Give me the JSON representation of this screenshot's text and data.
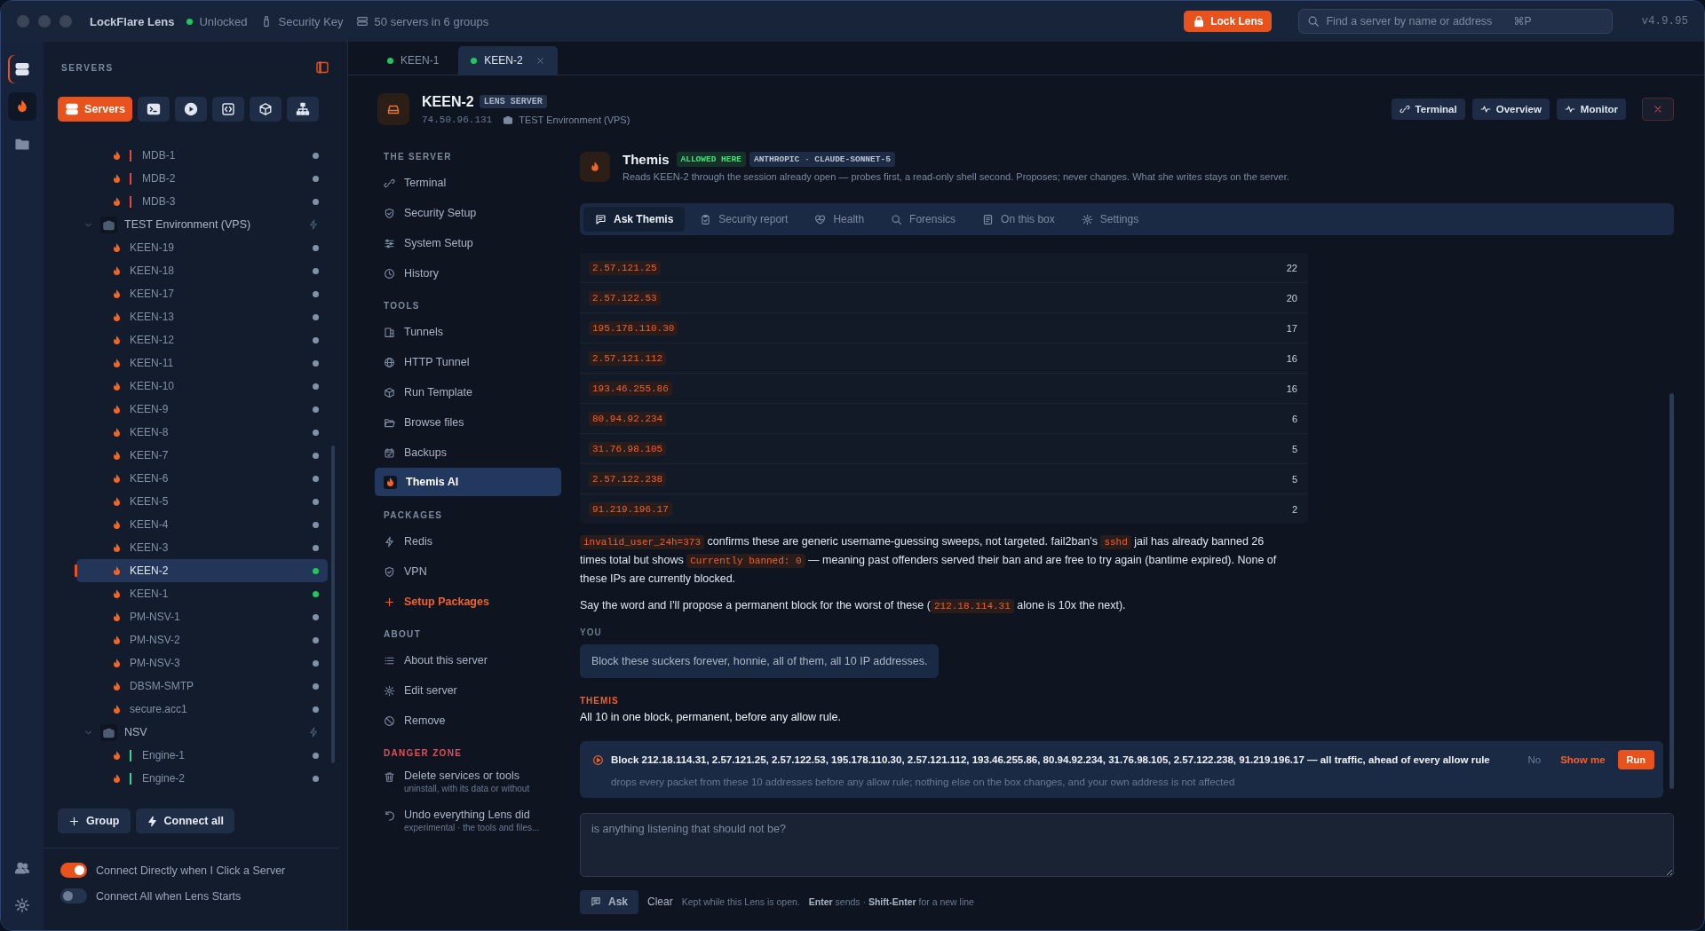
{
  "window": {
    "app_name": "LockFlare Lens",
    "lock_status": "Unlocked",
    "unlocked": true,
    "key_label": "Security Key",
    "server_count": "50 servers in 6 groups",
    "lock_button": "Lock Lens",
    "search": {
      "placeholder": "Find a server by name or address",
      "shortcut": "⌘P"
    },
    "version": "v4.9.95"
  },
  "sidebar": {
    "title": "SERVERS",
    "toolbar": [
      {
        "label": "Servers",
        "selected": true
      },
      {
        "selected": false
      },
      {
        "selected": false
      },
      {
        "selected": false
      },
      {
        "selected": false
      },
      {
        "selected": false
      }
    ],
    "tree": [
      {
        "kind": "server",
        "name": "MDB-1",
        "color": "#ef4444",
        "connected": false,
        "selected": false
      },
      {
        "kind": "server",
        "name": "MDB-2",
        "color": "#ef4444",
        "connected": false,
        "selected": false
      },
      {
        "kind": "server",
        "name": "MDB-3",
        "color": "#ef4444",
        "connected": false,
        "selected": false
      },
      {
        "kind": "group",
        "name": "TEST Environment (VPS)",
        "expanded": true,
        "children": [
          {
            "kind": "server",
            "name": "KEEN-19",
            "connected": false,
            "selected": false
          },
          {
            "kind": "server",
            "name": "KEEN-18",
            "connected": false,
            "selected": false
          },
          {
            "kind": "server",
            "name": "KEEN-17",
            "connected": false,
            "selected": false
          },
          {
            "kind": "server",
            "name": "KEEN-13",
            "connected": false,
            "selected": false
          },
          {
            "kind": "server",
            "name": "KEEN-12",
            "connected": false,
            "selected": false
          },
          {
            "kind": "server",
            "name": "KEEN-11",
            "connected": false,
            "selected": false
          },
          {
            "kind": "server",
            "name": "KEEN-10",
            "connected": false,
            "selected": false
          },
          {
            "kind": "server",
            "name": "KEEN-9",
            "connected": false,
            "selected": false
          },
          {
            "kind": "server",
            "name": "KEEN-8",
            "connected": false,
            "selected": false
          },
          {
            "kind": "server",
            "name": "KEEN-7",
            "connected": false,
            "selected": false
          },
          {
            "kind": "server",
            "name": "KEEN-6",
            "connected": false,
            "selected": false
          },
          {
            "kind": "server",
            "name": "KEEN-5",
            "connected": false,
            "selected": false
          },
          {
            "kind": "server",
            "name": "KEEN-4",
            "connected": false,
            "selected": false
          },
          {
            "kind": "server",
            "name": "KEEN-3",
            "connected": false,
            "selected": false
          },
          {
            "kind": "server",
            "name": "KEEN-2",
            "connected": true,
            "selected": true
          },
          {
            "kind": "server",
            "name": "KEEN-1",
            "connected": true,
            "selected": false
          },
          {
            "kind": "server",
            "name": "PM-NSV-1",
            "connected": false,
            "selected": false
          },
          {
            "kind": "server",
            "name": "PM-NSV-2",
            "connected": false,
            "selected": false
          },
          {
            "kind": "server",
            "name": "PM-NSV-3",
            "connected": false,
            "selected": false
          },
          {
            "kind": "server",
            "name": "DBSM-SMTP",
            "connected": false,
            "selected": false
          },
          {
            "kind": "server",
            "name": "secure.acc1",
            "connected": false,
            "selected": false
          }
        ]
      },
      {
        "kind": "group",
        "name": "NSV",
        "expanded": true,
        "children": [
          {
            "kind": "server",
            "name": "Engine-1",
            "color": "#34d399",
            "connected": false,
            "selected": false
          },
          {
            "kind": "server",
            "name": "Engine-2",
            "color": "#34d399",
            "connected": false,
            "selected": false
          }
        ]
      }
    ],
    "actions": [
      "Group",
      "Connect all"
    ],
    "toggles": [
      {
        "label": "Connect Directly when I Click a Server",
        "on": true
      },
      {
        "label": "Connect All when Lens Starts",
        "on": false
      }
    ]
  },
  "tabs": [
    {
      "label": "KEEN-1",
      "connected": true,
      "selected": false
    },
    {
      "label": "KEEN-2",
      "connected": true,
      "selected": true
    }
  ],
  "server": {
    "name": "KEEN-2",
    "badge": "LENS SERVER",
    "address": "74.50.96.131",
    "group": "TEST Environment (VPS)",
    "actions": [
      "Terminal",
      "Overview",
      "Monitor"
    ]
  },
  "server_nav": [
    {
      "heading": "THE SERVER",
      "kind": "normal",
      "items": [
        {
          "label": "Terminal",
          "selected": false
        },
        {
          "label": "Security Setup",
          "selected": false
        },
        {
          "label": "System Setup",
          "selected": false
        },
        {
          "label": "History",
          "selected": false
        }
      ]
    },
    {
      "heading": "TOOLS",
      "kind": "normal",
      "items": [
        {
          "label": "Tunnels",
          "selected": false
        },
        {
          "label": "HTTP Tunnel",
          "selected": false
        },
        {
          "label": "Run Template",
          "selected": false
        },
        {
          "label": "Browse files",
          "selected": false
        },
        {
          "label": "Backups",
          "selected": false
        },
        {
          "label": "Themis AI",
          "selected": true
        }
      ]
    },
    {
      "heading": "PACKAGES",
      "kind": "normal",
      "items": [
        {
          "label": "Redis",
          "selected": false
        },
        {
          "label": "VPN",
          "selected": false
        },
        {
          "label": "Setup Packages",
          "kind": "action",
          "selected": false
        }
      ]
    },
    {
      "heading": "ABOUT",
      "kind": "normal",
      "items": [
        {
          "label": "About this server",
          "selected": false
        },
        {
          "label": "Edit server",
          "selected": false
        },
        {
          "label": "Remove",
          "selected": false
        }
      ]
    },
    {
      "heading": "DANGER ZONE",
      "kind": "danger",
      "items": [
        {
          "label": "Delete services or tools",
          "subtitle": "uninstall, with its data or without",
          "selected": false
        },
        {
          "label": "Undo everything Lens did",
          "subtitle": "experimental · the tools and files...",
          "selected": false
        }
      ]
    }
  ],
  "assistant": {
    "name": "Themis",
    "badges": [
      {
        "text": "ALLOWED HERE",
        "kind": "allowed"
      },
      {
        "text": "ANTHROPIC · CLAUDE-SONNET-5",
        "kind": "model"
      }
    ],
    "description": "Reads KEEN-2 through the session already open — probes first, a read-only shell second. Proposes; never changes. What she writes stays on the server.",
    "tabs": [
      {
        "label": "Ask Themis",
        "selected": true
      },
      {
        "label": "Security report",
        "selected": false
      },
      {
        "label": "Health",
        "selected": false
      },
      {
        "label": "Forensics",
        "selected": false
      },
      {
        "label": "On this box",
        "selected": false
      },
      {
        "label": "Settings",
        "selected": false
      }
    ],
    "chat": {
      "table": {
        "rows": [
          {
            "address": "2.57.121.25",
            "count": "22"
          },
          {
            "address": "2.57.122.53",
            "count": "20"
          },
          {
            "address": "195.178.110.30",
            "count": "17"
          },
          {
            "address": "2.57.121.112",
            "count": "16"
          },
          {
            "address": "193.46.255.86",
            "count": "16"
          },
          {
            "address": "80.94.92.234",
            "count": "6"
          },
          {
            "address": "31.76.98.105",
            "count": "5"
          },
          {
            "address": "2.57.122.238",
            "count": "5"
          },
          {
            "address": "91.219.196.17",
            "count": "2"
          }
        ]
      },
      "paragraphs": [
        [
          {
            "text": "invalid_user_24h=373",
            "kind": "code"
          },
          {
            "text": " confirms these are generic username-guessing sweeps, not targeted. fail2ban's ",
            "kind": "text"
          },
          {
            "text": "sshd",
            "kind": "code"
          },
          {
            "text": " jail has already banned 26 times total but shows ",
            "kind": "text"
          },
          {
            "text": "Currently banned: 0",
            "kind": "code"
          },
          {
            "text": " — meaning past offenders served their ban and are free to try again (bantime expired). None of these IPs are currently blocked.",
            "kind": "text"
          }
        ],
        [
          {
            "text": "Say the word and I'll propose a permanent block for the worst of these (",
            "kind": "text"
          },
          {
            "text": "212.18.114.31",
            "kind": "code"
          },
          {
            "text": " alone is 10x the next).",
            "kind": "text"
          }
        ]
      ],
      "messages": [
        {
          "kind": "user",
          "label": "YOU",
          "text": "Block these suckers forever, honnie, all of them, all 10 IP addresses."
        },
        {
          "kind": "assistant",
          "label": "THEMIS",
          "text": "All 10 in one block, permanent, before any allow rule."
        }
      ],
      "proposal": {
        "title": "Block 212.18.114.31, 2.57.121.25, 2.57.122.53, 195.178.110.30, 2.57.121.112, 193.46.255.86, 80.94.92.234, 31.76.98.105, 2.57.122.238, 91.219.196.17 — all traffic, ahead of every allow rule",
        "detail": "drops every packet from these 10 addresses before any allow rule; nothing else on the box changes, and your own address is not affected",
        "actions": [
          {
            "label": "No",
            "kind": "dismiss"
          },
          {
            "label": "Show me",
            "kind": "link"
          },
          {
            "label": "Run",
            "kind": "primary"
          }
        ]
      }
    },
    "composer": {
      "placeholder": "is anything listening that should not be?",
      "send": "Ask",
      "clear": "Clear",
      "note": "Kept while this Lens is open.",
      "hint": "**Enter** sends · **Shift-Enter** for a new line"
    }
  }
}
